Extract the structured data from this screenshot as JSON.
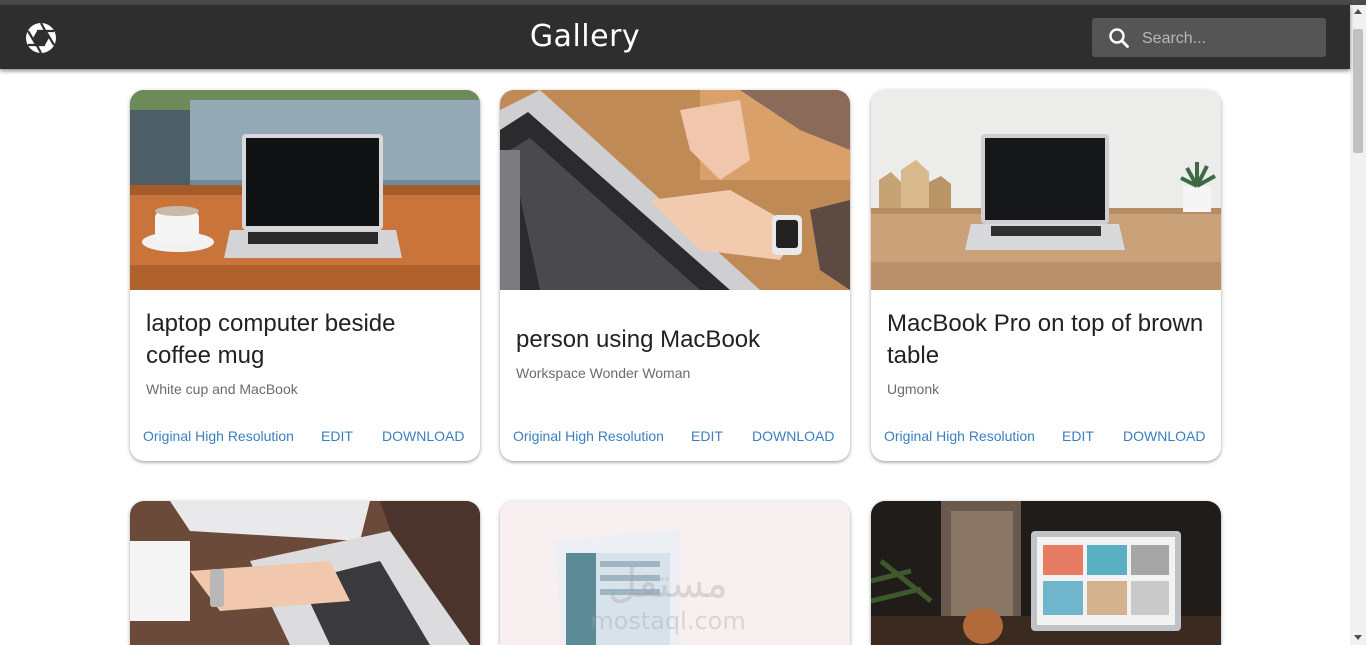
{
  "app": {
    "title": "Gallery",
    "logo_icon": "camera-aperture-icon"
  },
  "search": {
    "placeholder": "Search...",
    "value": "",
    "icon": "search-icon"
  },
  "colors": {
    "appbar": "#2e2e2e",
    "action_link": "#3a7fc0",
    "search_field": "#555555"
  },
  "cards": [
    {
      "title": "laptop computer beside coffee mug",
      "subtitle": "White cup and MacBook",
      "actions": [
        "Original High Resolution",
        "EDIT",
        "DOWNLOAD"
      ]
    },
    {
      "title": "person using MacBook",
      "subtitle": "Workspace Wonder Woman",
      "actions": [
        "Original High Resolution",
        "EDIT",
        "DOWNLOAD"
      ]
    },
    {
      "title": "MacBook Pro on top of brown table",
      "subtitle": "Ugmonk",
      "actions": [
        "Original High Resolution",
        "EDIT",
        "DOWNLOAD"
      ]
    }
  ],
  "watermark": {
    "line1": "مستقل",
    "line2": "mostaql.com"
  }
}
